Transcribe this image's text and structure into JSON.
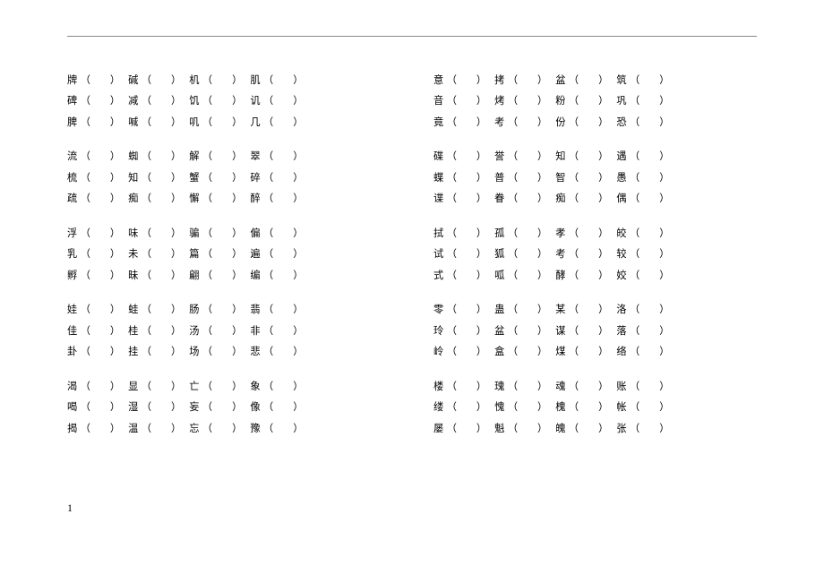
{
  "open_paren": "（",
  "close_paren": "）",
  "page_number": "1",
  "left": [
    {
      "rows": [
        [
          "牌",
          "碱",
          "机",
          "肌"
        ],
        [
          "碑",
          "减",
          "饥",
          "讥"
        ],
        [
          "脾",
          "喊",
          "叽",
          "几"
        ]
      ]
    },
    {
      "rows": [
        [
          "流",
          "蜘",
          "解",
          "翠"
        ],
        [
          "梳",
          "知",
          "蟹",
          "碎"
        ],
        [
          "疏",
          "痴",
          "懈",
          "醉"
        ]
      ]
    },
    {
      "rows": [
        [
          "浮",
          "味",
          "骗",
          "偏"
        ],
        [
          "乳",
          "未",
          "篇",
          "遍"
        ],
        [
          "孵",
          "昧",
          "翩",
          "编"
        ]
      ]
    },
    {
      "rows": [
        [
          "娃",
          "蛙",
          "肠",
          "翡"
        ],
        [
          "佳",
          "桂",
          "汤",
          "非"
        ],
        [
          "卦",
          "挂",
          "场",
          "悲"
        ]
      ]
    },
    {
      "rows": [
        [
          "渴",
          "显",
          "亡",
          "象"
        ],
        [
          "喝",
          "湿",
          "妄",
          "像"
        ],
        [
          "揭",
          "温",
          "忘",
          "豫"
        ]
      ]
    }
  ],
  "right": [
    {
      "rows": [
        [
          "意",
          "拷",
          "盆",
          "筑"
        ],
        [
          "音",
          "烤",
          "粉",
          "巩"
        ],
        [
          "竟",
          "考",
          "份",
          "恐"
        ]
      ]
    },
    {
      "rows": [
        [
          "碟",
          "誉",
          "知",
          "遇"
        ],
        [
          "蝶",
          "普",
          "智",
          "愚"
        ],
        [
          "谍",
          "眷",
          "痴",
          "偶"
        ]
      ]
    },
    {
      "rows": [
        [
          "拭",
          "孤",
          "孝",
          "皎"
        ],
        [
          "试",
          "狐",
          "考",
          "较"
        ],
        [
          "式",
          "呱",
          "酵",
          "姣"
        ]
      ]
    },
    {
      "rows": [
        [
          "零",
          "蛊",
          "某",
          "洛"
        ],
        [
          "玲",
          "盆",
          "谋",
          "落"
        ],
        [
          "岭",
          "盒",
          "煤",
          "络"
        ]
      ]
    },
    {
      "rows": [
        [
          "楼",
          "瑰",
          "魂",
          "账"
        ],
        [
          "缕",
          "愧",
          "槐",
          "帐"
        ],
        [
          "屡",
          "魁",
          "魄",
          "张"
        ]
      ]
    }
  ]
}
